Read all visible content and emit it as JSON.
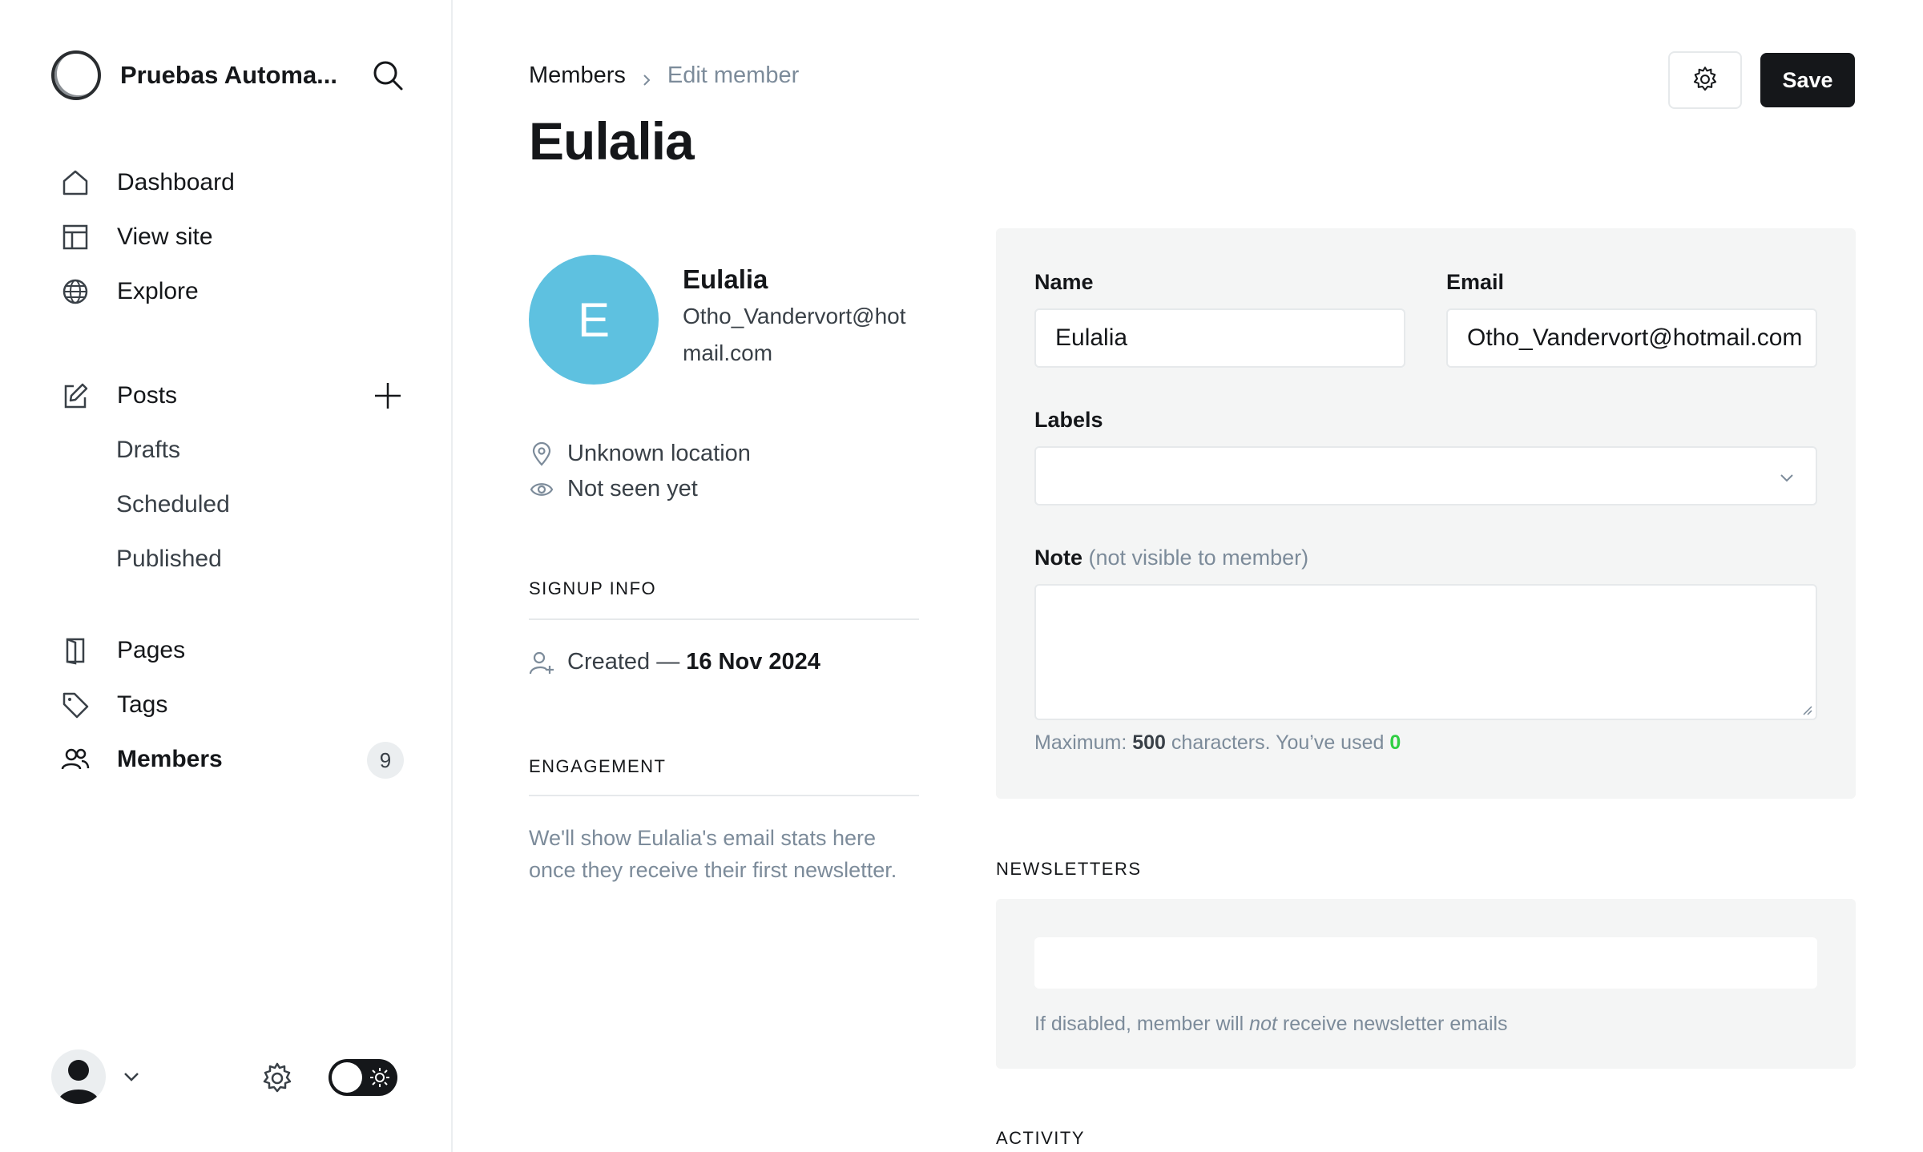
{
  "sidebar": {
    "site_name": "Pruebas Automa...",
    "nav": {
      "dashboard": "Dashboard",
      "view_site": "View site",
      "explore": "Explore",
      "posts": "Posts",
      "drafts": "Drafts",
      "scheduled": "Scheduled",
      "published": "Published",
      "pages": "Pages",
      "tags": "Tags",
      "members": "Members",
      "members_count": "9"
    }
  },
  "header": {
    "breadcrumb_parent": "Members",
    "breadcrumb_current": "Edit member",
    "title": "Eulalia",
    "save_label": "Save"
  },
  "profile": {
    "initial": "E",
    "avatar_color": "#5ec1e0",
    "name": "Eulalia",
    "email": "Otho_Vandervort@hotmail.com",
    "location": "Unknown location",
    "last_seen": "Not seen yet"
  },
  "signup": {
    "heading": "SIGNUP INFO",
    "created_prefix": "Created —",
    "created_date": "16 Nov 2024"
  },
  "engagement": {
    "heading": "ENGAGEMENT",
    "text": "We'll show Eulalia's email stats here once they receive their first newsletter."
  },
  "form": {
    "name_label": "Name",
    "name_value": "Eulalia",
    "email_label": "Email",
    "email_value": "Otho_Vandervort@hotmail.com",
    "labels_label": "Labels",
    "note_label": "Note",
    "note_muted": "(not visible to member)",
    "hint_prefix": "Maximum:",
    "hint_max": "500",
    "hint_middle": "characters. You’ve used",
    "hint_used": "0"
  },
  "newsletters": {
    "heading": "NEWSLETTERS",
    "hint_before": "If disabled, member will",
    "hint_em": "not",
    "hint_after": "receive newsletter emails"
  },
  "activity": {
    "heading": "ACTIVITY"
  },
  "colors": {
    "primary": "#15171a",
    "accent_green": "#30cf43",
    "muted": "#7c8b9a",
    "panel_bg": "#f4f5f5"
  }
}
